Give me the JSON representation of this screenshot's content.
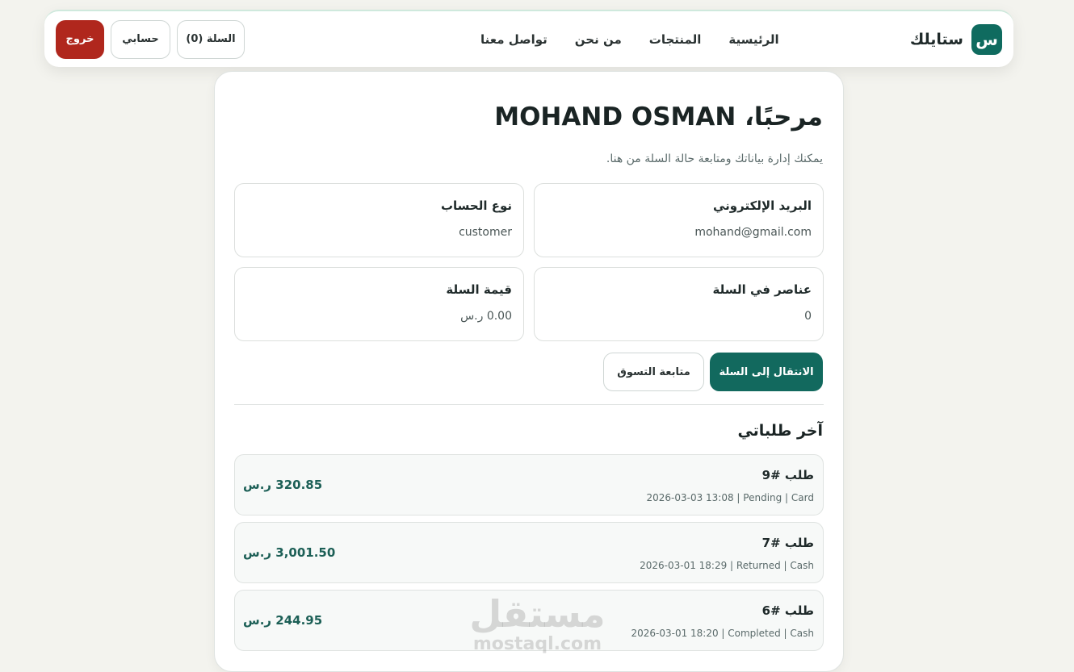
{
  "brand": {
    "logo_letter": "س",
    "name": "ستايلك",
    "color": "#0f6b5f"
  },
  "nav": {
    "links": [
      "الرئيسية",
      "المنتجات",
      "من نحن",
      "تواصل معنا"
    ],
    "cart_label": "السلة (0)",
    "account_label": "حسابي",
    "logout_label": "خروج"
  },
  "profile": {
    "greeting": "مرحبًا، MOHAND OSMAN",
    "subtitle": "يمكنك إدارة بياناتك ومتابعة حالة السلة من هنا.",
    "info": [
      {
        "label": "البريد الإلكتروني",
        "value": "mohand@gmail.com"
      },
      {
        "label": "نوع الحساب",
        "value": "customer"
      },
      {
        "label": "عناصر في السلة",
        "value": "0"
      },
      {
        "label": "قيمة السلة",
        "value": "0.00 ر.س"
      }
    ],
    "go_to_cart_label": "الانتقال إلى السلة",
    "continue_shopping_label": "متابعة التسوق"
  },
  "orders": {
    "title": "آخر طلباتي",
    "items": [
      {
        "id": "طلب #9",
        "meta": "2026-03-03 13:08 | Pending | Card",
        "total": "320.85 ر.س"
      },
      {
        "id": "طلب #7",
        "meta": "2026-03-01 18:29 | Returned | Cash",
        "total": "3,001.50 ر.س"
      },
      {
        "id": "طلب #6",
        "meta": "2026-03-01 18:20 | Completed | Cash",
        "total": "244.95 ر.س"
      }
    ]
  },
  "watermark": {
    "arabic": "مستقل",
    "latin": "mostaql.com"
  },
  "colors": {
    "accent": "#12695e",
    "danger": "#b0271d",
    "background": "#f3f3ee"
  }
}
